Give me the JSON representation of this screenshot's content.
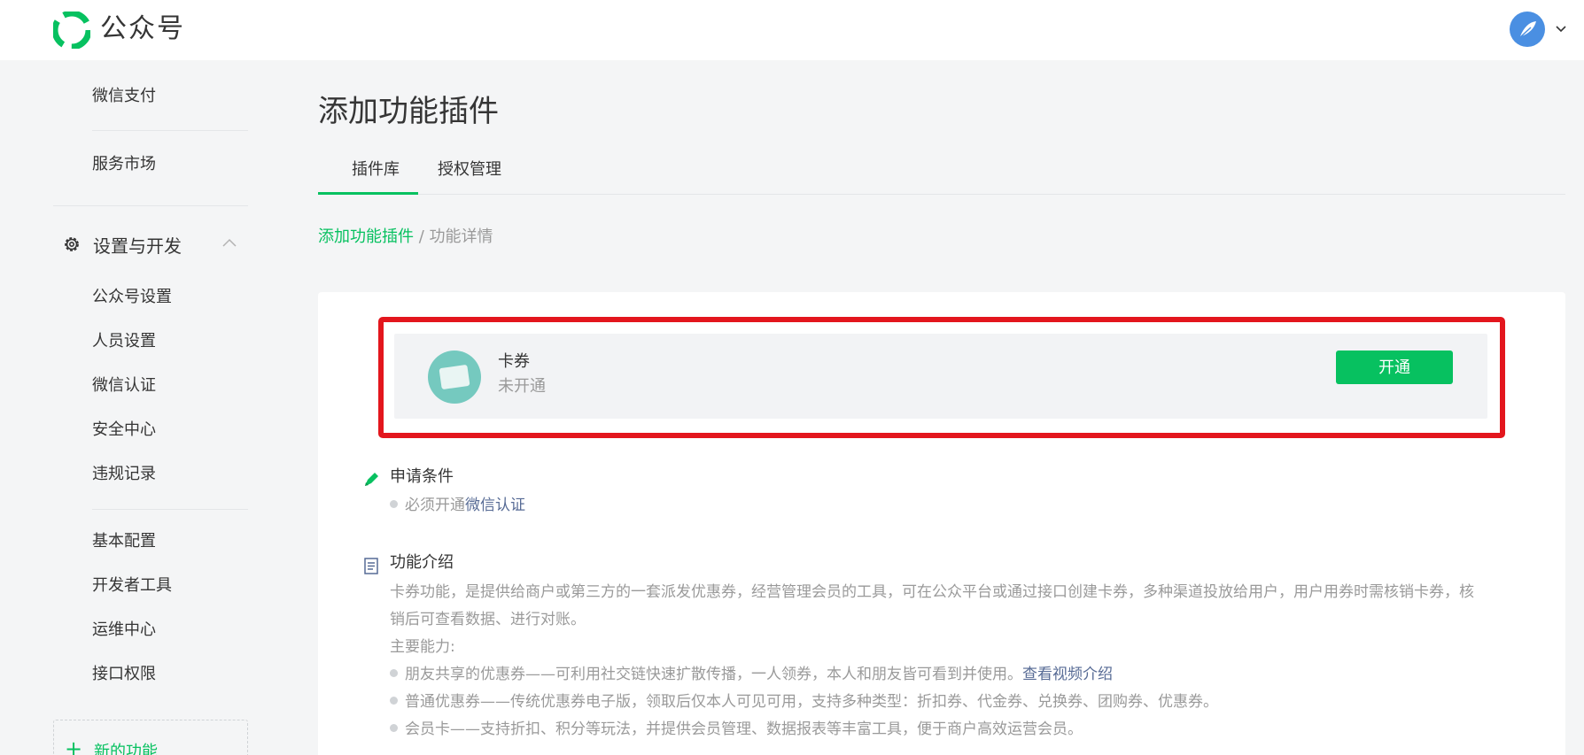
{
  "header": {
    "brand": "公众号",
    "logo_icon": "wechat-official-account-logo",
    "avatar_icon": "feather-avatar",
    "account_caret_icon": "chevron-down-icon",
    "brand_color": "#07c160"
  },
  "sidebar": {
    "items_top": [
      {
        "label": "微信支付"
      },
      {
        "label": "服务市场"
      }
    ],
    "section": {
      "label": "设置与开发",
      "icon": "gear-icon",
      "toggle_icon": "chevron-up-icon"
    },
    "items_settings": [
      {
        "label": "公众号设置"
      },
      {
        "label": "人员设置"
      },
      {
        "label": "微信认证"
      },
      {
        "label": "安全中心"
      },
      {
        "label": "违规记录"
      }
    ],
    "items_dev": [
      {
        "label": "基本配置"
      },
      {
        "label": "开发者工具"
      },
      {
        "label": "运维中心"
      },
      {
        "label": "接口权限"
      }
    ],
    "new_feature": {
      "plus": "+",
      "label": "新的功能"
    }
  },
  "main": {
    "title": "添加功能插件",
    "tabs": [
      {
        "label": "插件库",
        "active": true
      },
      {
        "label": "授权管理",
        "active": false
      }
    ],
    "breadcrumb": {
      "link": "添加功能插件",
      "separator": "/",
      "current": "功能详情"
    },
    "plugin": {
      "name": "卡券",
      "status": "未开通",
      "button": "开通",
      "icon": "card-coupon-icon",
      "highlight_color": "#e3161d"
    },
    "conditions": {
      "title": "申请条件",
      "icon": "pencil-icon",
      "item_prefix": "必须开通",
      "item_link": "微信认证"
    },
    "intro": {
      "title": "功能介绍",
      "icon": "document-icon",
      "paragraph_line1": "卡券功能，是提供给商户或第三方的一套派发优惠券，经营管理会员的工具，可在公众平台或通过接口创建卡券，多种渠道投放给用户，用户用券时需核销卡券，核",
      "paragraph_line2": "销后可查看数据、进行对账。",
      "abilities_label": "主要能力:",
      "abilities": [
        {
          "text": "朋友共享的优惠券——可利用社交链快速扩散传播，一人领券，本人和朋友皆可看到并使用。",
          "link": "查看视频介绍"
        },
        {
          "text": "普通优惠券——传统优惠券电子版，领取后仅本人可见可用，支持多种类型：折扣券、代金券、兑换券、团购券、优惠券。",
          "link": ""
        },
        {
          "text": "会员卡——支持折扣、积分等玩法，并提供会员管理、数据报表等丰富工具，便于商户高效运营会员。",
          "link": ""
        }
      ]
    }
  }
}
